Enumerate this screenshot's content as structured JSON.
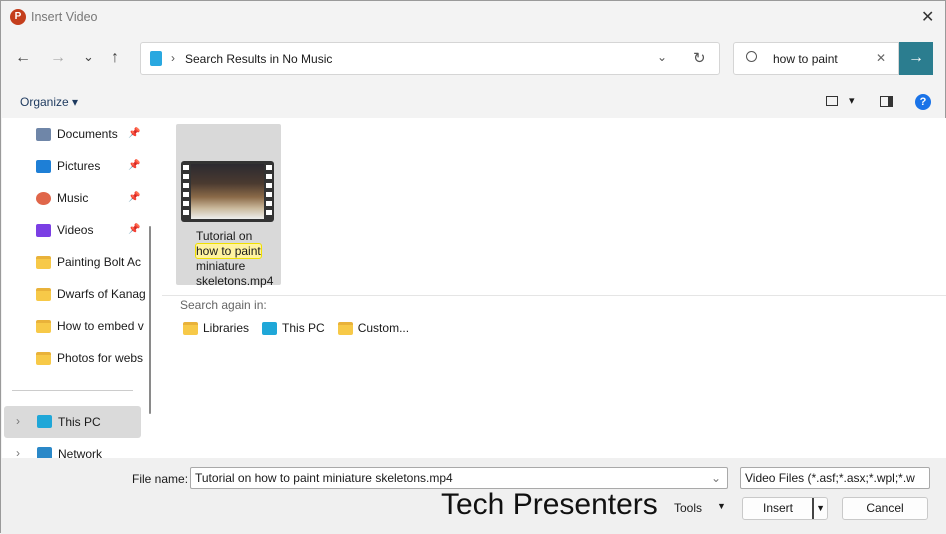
{
  "window": {
    "title": "Insert Video",
    "app_icon": "powerpoint-icon",
    "close": "✕"
  },
  "nav": {
    "back": "←",
    "forward": "→",
    "recent": "⌄",
    "up": "↑"
  },
  "address": {
    "separator": "›",
    "path": "Search Results in No Music",
    "dropdown": "⌄",
    "refresh": "↻"
  },
  "search": {
    "value": "how to paint",
    "clear": "✕",
    "go": "→"
  },
  "toolbar": {
    "organize": "Organize ▾",
    "view": "▾",
    "help": "?"
  },
  "sidebar": {
    "items": [
      {
        "label": "Documents",
        "icon": "documents-icon",
        "pinned": true
      },
      {
        "label": "Pictures",
        "icon": "pictures-icon",
        "pinned": true
      },
      {
        "label": "Music",
        "icon": "music-icon",
        "pinned": true
      },
      {
        "label": "Videos",
        "icon": "videos-icon",
        "pinned": true
      },
      {
        "label": "Painting Bolt Ac",
        "icon": "folder-icon"
      },
      {
        "label": "Dwarfs of Kanag",
        "icon": "folder-icon"
      },
      {
        "label": "How to embed v",
        "icon": "folder-icon"
      },
      {
        "label": "Photos for webs",
        "icon": "folder-icon"
      }
    ],
    "this_pc": "This PC",
    "network": "Network"
  },
  "results": {
    "file": {
      "line1": "Tutorial on",
      "highlight": "how to paint",
      "line3": "miniature",
      "line4": "skeletons.mp4"
    },
    "search_again": "Search again in:",
    "locations": [
      "Libraries",
      "This PC",
      "Custom..."
    ]
  },
  "footer": {
    "file_name_label": "File name:",
    "file_name_value": "Tutorial on how to paint miniature skeletons.mp4",
    "filter": "Video Files (*.asf;*.asx;*.wpl;*.w",
    "watermark": "Tech Presenters",
    "tools": "Tools",
    "insert": "Insert",
    "cancel": "Cancel"
  }
}
